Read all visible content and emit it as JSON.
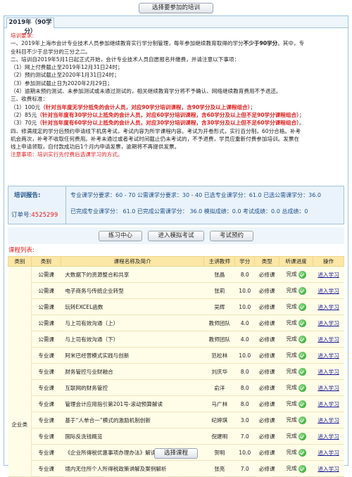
{
  "top_button": "选择要参加的培训",
  "tab": "2019年（90学分）",
  "requirements": {
    "heading": "培训要求:",
    "p1a": "一、2019年上海市会计专业技术人员参加继续教育实行学分制管理，每年参加继续教育取得的学分",
    "p1b": "不少于90学分",
    "p1c": "。其中，专",
    "p1d": "业科目不少于总学分的三分之二。",
    "p2": "二、培训自2019年5月1日起正式开始，会计专业技术人员自愿报名并缴费，并请注意以下事项：",
    "i1": "（1）网上付费截止至2019年12月31日24时；",
    "i2": "（2）预约测试截止至2020年1月31日24时；",
    "i3": "（3）参加测试截止日为2020年2月29日；",
    "i4": "（4）逾期未预约测试、未参加测试或未通过测试的，相关继续教育学分将不予确认、网络继续教育费用不予退还。",
    "p3": "三、收费标准：",
    "f1a": "（1）100元",
    "f1b": "（针对当年度无学分抵免的会计人员，对应90学分培训课程，含90学分及以上课程组合）",
    "f1c": "；",
    "f2a": "（2）85元",
    "f2b": "（针对当年度有30学分以上抵免的会计人员，对应60学分培训课程，含60学分及以上但不足90学分课程组合）",
    "f2c": "；",
    "f3a": "（3）70元",
    "f3b": "（针对当年度有60学分以上抵免的会计人员，对应30学分培训课程，含30学分及以上但不足60学分课程组合）",
    "f3c": "。",
    "p4a": "四、修满规定的学分后预约申请线下机房考试，考试内容为所学课程内容。考试为开卷形式，实行百分制，60分合格。补考",
    "p4b": "机会两次，补考不收取任何费用。补考未通过或者考试时间截止仍未考试的，不予退费，学员应重新付费参加培训。发票在",
    "p4c": "线上申请领取，自付款成功后1个月内申请发票，逾期将不再提供发票。",
    "note_label": "注意事项：",
    "note": "培训实行先付费后选课学习的方式。"
  },
  "report": {
    "label": "培训报告:",
    "order_label": "订单号:",
    "order_no": "4525299",
    "row1": "专业课学分要求：60 - 70    公需课学分要求：30 - 40    已选专业课学分：61.0    已选公需课学分：36.0",
    "row2": "已完成专业课学分：  61.0      已完成公需课学分：  36.0      模拟成绩：0.0    考试成绩：0.0    总成绩：0"
  },
  "actions": [
    "练习中心",
    "进入模拟考试",
    "考试预约"
  ],
  "list_title": "课程列表:",
  "table": {
    "headers": [
      "类别",
      "类别",
      "课程名称及简介",
      "主讲教师",
      "学分",
      "类型",
      "听课进度",
      "操作"
    ],
    "group_label": "企业类",
    "rows": [
      {
        "cat": "公需课",
        "name": "大数据下的资源整合和共享",
        "teacher": "张晶",
        "credit": "8.0",
        "type": "必修课",
        "progress": "完成",
        "op": "进入学习"
      },
      {
        "cat": "公需课",
        "name": "电子商务与传统企业转型",
        "teacher": "张莉",
        "credit": "10.0",
        "type": "必修课",
        "progress": "完成",
        "op": "进入学习"
      },
      {
        "cat": "公需课",
        "name": "玩转EXCEL函数",
        "teacher": "吴辉",
        "credit": "10.0",
        "type": "必修课",
        "progress": "完成",
        "op": "进入学习"
      },
      {
        "cat": "公需课",
        "name": "与上司有效沟通（上）",
        "teacher": "教师团队",
        "credit": "4.0",
        "type": "必修课",
        "progress": "完成",
        "op": "进入学习"
      },
      {
        "cat": "公需课",
        "name": "与上司有效沟通（下）",
        "teacher": "教师团队",
        "credit": "4.0",
        "type": "必修课",
        "progress": "完成",
        "op": "进入学习"
      },
      {
        "cat": "专业课",
        "name": "阿米巴经营模式实践与创新",
        "teacher": "范松林",
        "credit": "10.0",
        "type": "必修课",
        "progress": "完成",
        "op": "进入学习"
      },
      {
        "cat": "专业课",
        "name": "财务管控与业财融合",
        "teacher": "刘庆华",
        "credit": "8.0",
        "type": "必修课",
        "progress": "完成",
        "op": "进入学习"
      },
      {
        "cat": "专业课",
        "name": "互联网的财务管控",
        "teacher": "俞洋",
        "credit": "8.0",
        "type": "必修课",
        "progress": "完成",
        "op": "进入学习"
      },
      {
        "cat": "专业课",
        "name": "管理会计应用指引第201号-滚动预算解读",
        "teacher": "马广林",
        "credit": "8.0",
        "type": "必修课",
        "progress": "完成",
        "op": "进入学习"
      },
      {
        "cat": "专业课",
        "name": "基于“人单合一”模式的激励机制创新",
        "teacher": "纪婷琪",
        "credit": "3.0",
        "type": "必修课",
        "progress": "完成",
        "op": "进入学习"
      },
      {
        "cat": "专业课",
        "name": "国际反洗钱概览",
        "teacher": "倪建明",
        "credit": "7.0",
        "type": "必修课",
        "progress": "完成",
        "op": "进入学习"
      },
      {
        "cat": "专业课",
        "name": "《企业所得税优惠事项办理办法》解读与风险防范",
        "teacher": "贺明",
        "credit": "10.0",
        "type": "必修课",
        "progress": "完成",
        "op": "进入学习"
      },
      {
        "cat": "专业课",
        "name": "境内无住所个人所得税政策讲解及案例解析",
        "teacher": "张亮",
        "credit": "7.0",
        "type": "必修课",
        "progress": "完成",
        "op": "进入学习"
      }
    ]
  },
  "bottom_button": "选择课程"
}
